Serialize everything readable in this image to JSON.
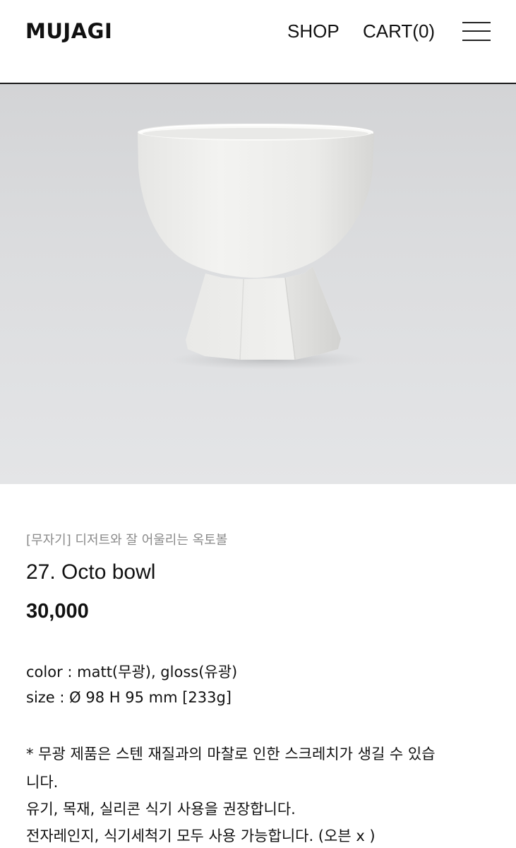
{
  "header": {
    "logo": "MUJAGI",
    "nav": {
      "shop": "SHOP",
      "cart": "CART(0)"
    },
    "menu_icon": "hamburger-menu-icon"
  },
  "hero": {
    "image": "white-octo-bowl-photo"
  },
  "product": {
    "category": "[무자기] 디저트와 잘 어울리는 옥토볼",
    "title": "27. Octo bowl",
    "price": "30,000",
    "specs": [
      "color : matt(무광), gloss(유광)",
      "size : Ø 98 H 95 mm [233g]"
    ],
    "notes": [
      "* 무광 제품은 스텐 재질과의 마찰로 인한 스크레치가 생길 수 있습",
      "니다.",
      "유기, 목재, 실리콘 식기 사용을 권장합니다.",
      "전자레인지, 식기세척기 모두 사용 가능합니다. (오븐 x )"
    ]
  }
}
